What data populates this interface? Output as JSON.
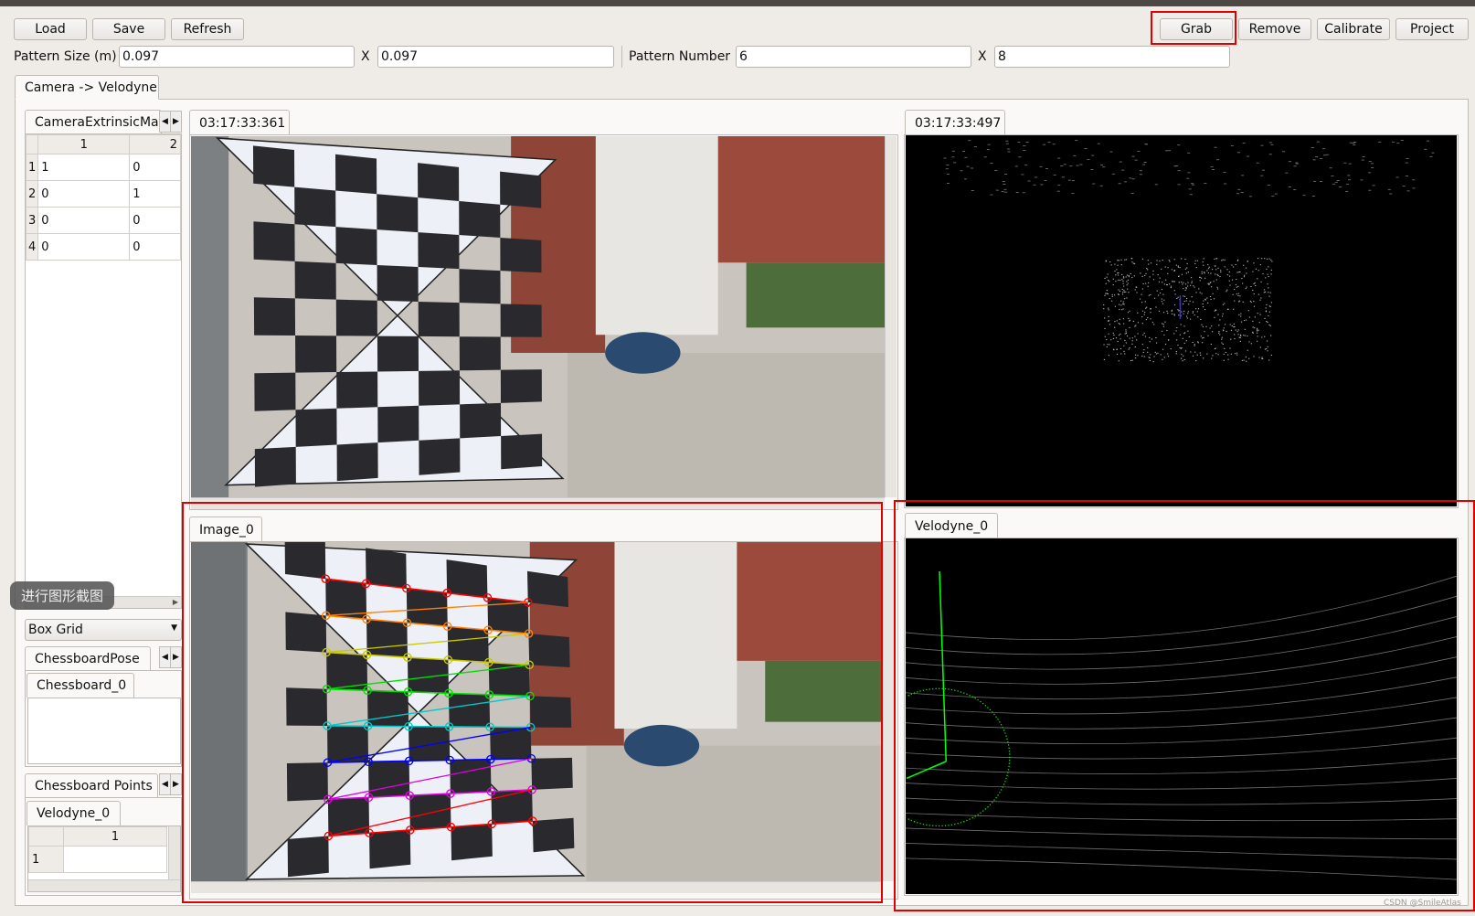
{
  "toolbar": {
    "load": "Load",
    "save": "Save",
    "refresh": "Refresh",
    "grab": "Grab",
    "remove": "Remove",
    "calibrate": "Calibrate",
    "project": "Project"
  },
  "pattern": {
    "size_label": "Pattern Size (m)",
    "size_x": "0.097",
    "size_y": "0.097",
    "x_sep": "X",
    "number_label": "Pattern Number",
    "number_x": "6",
    "number_y": "8"
  },
  "main_tab": "Camera -> Velodyne",
  "left": {
    "extrinsic_tab": "CameraExtrinsicMat",
    "extrinsic_cols": [
      "1",
      "2"
    ],
    "extrinsic_rows": [
      [
        "1",
        "1",
        "0"
      ],
      [
        "2",
        "0",
        "1"
      ],
      [
        "3",
        "0",
        "0"
      ],
      [
        "4",
        "0",
        "0"
      ]
    ],
    "tooltip": "进行图形截图",
    "combo": "Box Grid",
    "pose_tab": "ChessboardPose",
    "pose_subtab": "Chessboard_0",
    "points_tab": "Chessboard Points",
    "points_subtab": "Velodyne_0",
    "points_cols": [
      "1"
    ],
    "points_rows": [
      "1"
    ]
  },
  "views": {
    "camera_timestamp": "03:17:33:361",
    "lidar_timestamp": "03:17:33:497",
    "image_tab": "Image_0",
    "velodyne_tab": "Velodyne_0"
  },
  "corner_row_colors": [
    "#ff0000",
    "#ff8000",
    "#c8c800",
    "#00e000",
    "#00c8c8",
    "#0000ff",
    "#e000e0",
    "#ff0000"
  ],
  "colors": {
    "highlight": "#e00000",
    "lidar_axis": "#00ff00"
  },
  "watermark": "CSDN @SmileAtlas"
}
